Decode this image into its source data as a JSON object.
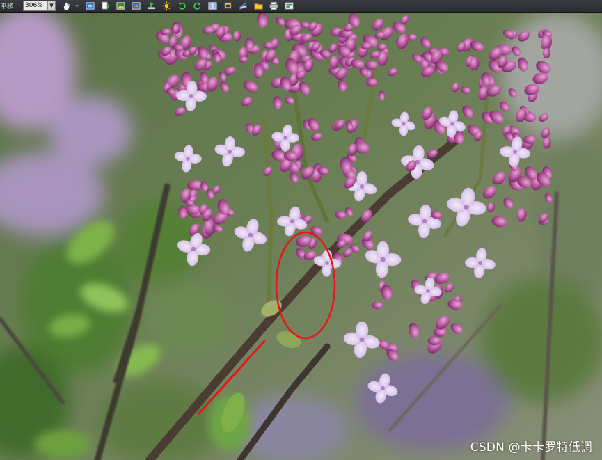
{
  "toolbar": {
    "label": "平移",
    "zoom_value": "306%",
    "buttons": [
      {
        "name": "hand-pan-icon"
      },
      {
        "name": "fit-window-icon"
      },
      {
        "name": "export-page-icon"
      },
      {
        "name": "image-view-icon"
      },
      {
        "name": "color-adjust-icon"
      },
      {
        "name": "stamp-icon"
      },
      {
        "name": "brightness-icon"
      },
      {
        "name": "rotate-left-icon"
      },
      {
        "name": "rotate-right-icon"
      },
      {
        "name": "two-page-icon"
      },
      {
        "name": "crop-icon"
      },
      {
        "name": "scanner-icon"
      },
      {
        "name": "folder-icon"
      },
      {
        "name": "print-icon"
      },
      {
        "name": "settings-panel-icon"
      }
    ]
  },
  "photo": {
    "subject": "lilac-branch-photo",
    "watermark": "CSDN @卡卡罗特低调",
    "annotation_color": "#e8141a"
  }
}
